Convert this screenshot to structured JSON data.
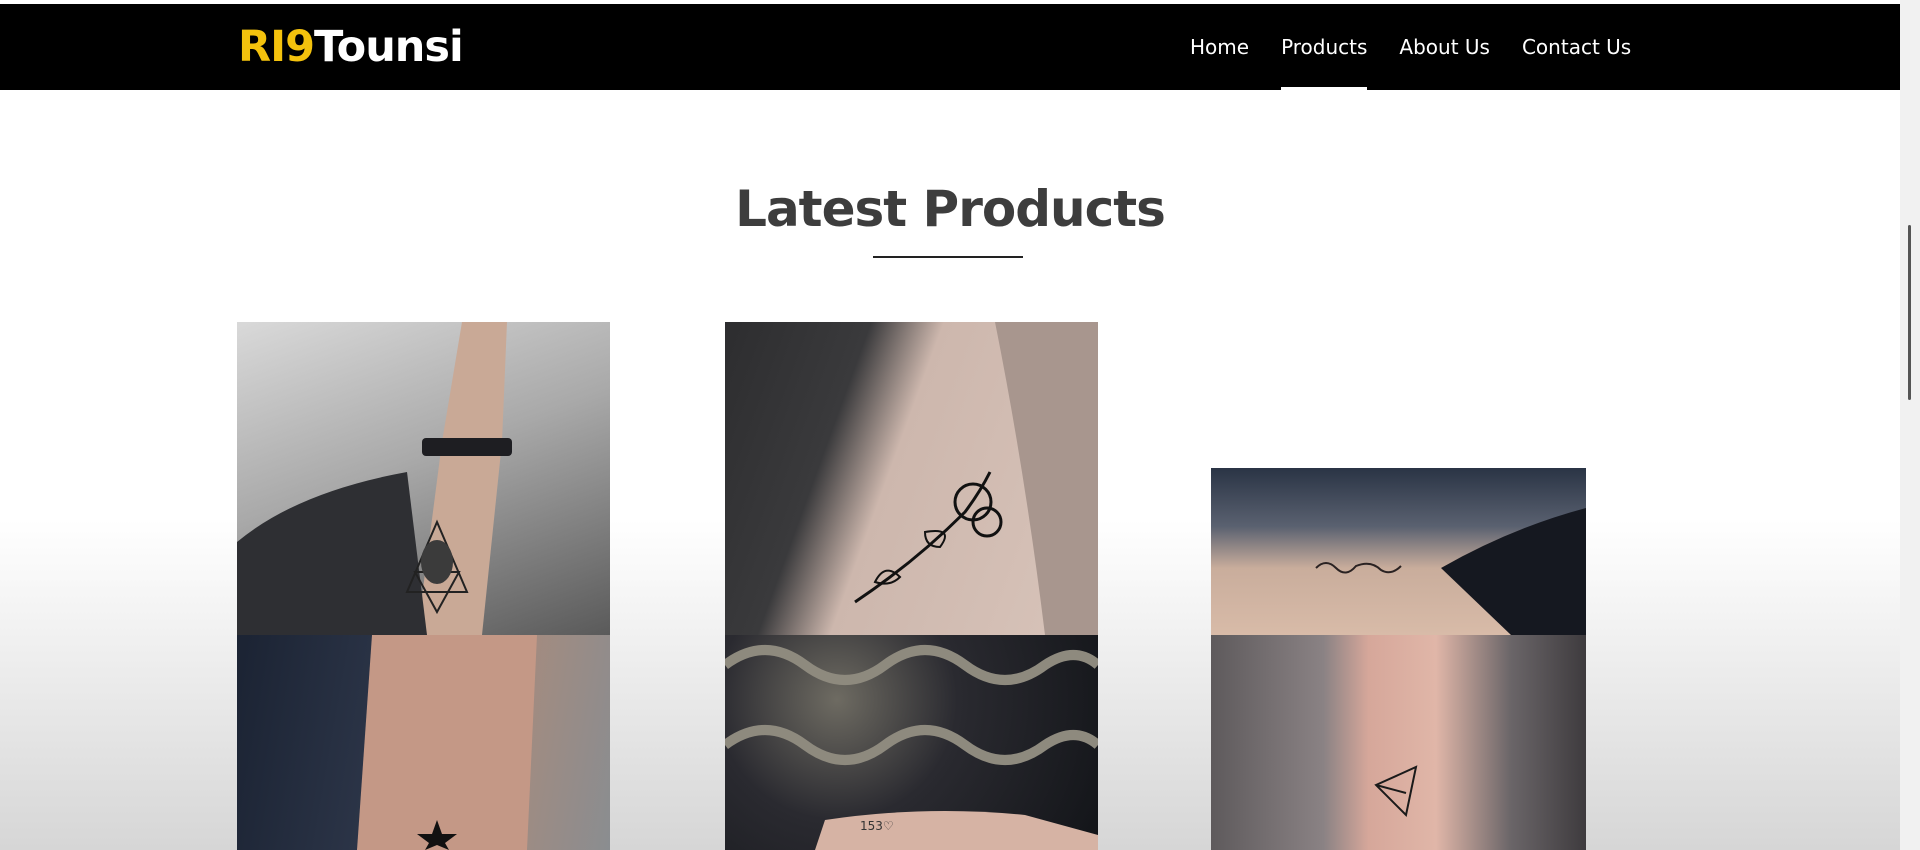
{
  "header": {
    "logo_part1": "RI9",
    "logo_part2": "Tounsi",
    "nav": [
      "Home",
      "Products",
      "About Us",
      "Contact Us"
    ],
    "active_index": 1
  },
  "section": {
    "title": "Latest Products"
  },
  "products": [
    {
      "icon": "geometric-arm-tattoo-image"
    },
    {
      "icon": "rose-side-tattoo-image"
    },
    {
      "icon": "script-rib-tattoo-image"
    },
    {
      "icon": "star-arm-tattoo-image"
    },
    {
      "icon": "finger-text-tattoo-image",
      "text": "153♡"
    },
    {
      "icon": "paper-plane-wrist-tattoo-image"
    }
  ]
}
